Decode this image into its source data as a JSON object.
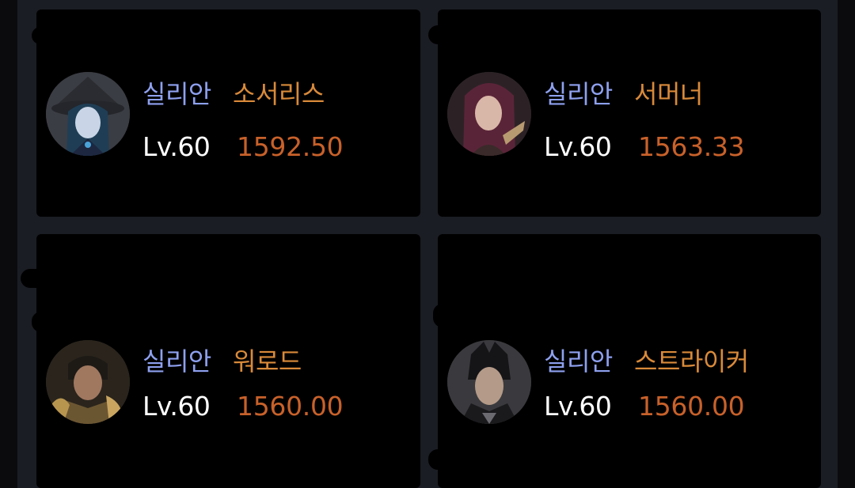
{
  "characters": [
    {
      "server": "실리안",
      "class": "소서리스",
      "level": "Lv.60",
      "item_level": "1592.50",
      "portrait": "sorceress-portrait-icon"
    },
    {
      "server": "실리안",
      "class": "서머너",
      "level": "Lv.60",
      "item_level": "1563.33",
      "portrait": "summoner-portrait-icon"
    },
    {
      "server": "실리안",
      "class": "워로드",
      "level": "Lv.60",
      "item_level": "1560.00",
      "portrait": "warlord-portrait-icon"
    },
    {
      "server": "실리안",
      "class": "스트라이커",
      "level": "Lv.60",
      "item_level": "1560.00",
      "portrait": "striker-portrait-icon"
    }
  ],
  "colors": {
    "background": "#1b1d24",
    "card": "#000000",
    "server_text": "#8ea0ef",
    "class_text": "#d98a3a",
    "level_text": "#ffffff",
    "item_level_text": "#c8612a"
  }
}
